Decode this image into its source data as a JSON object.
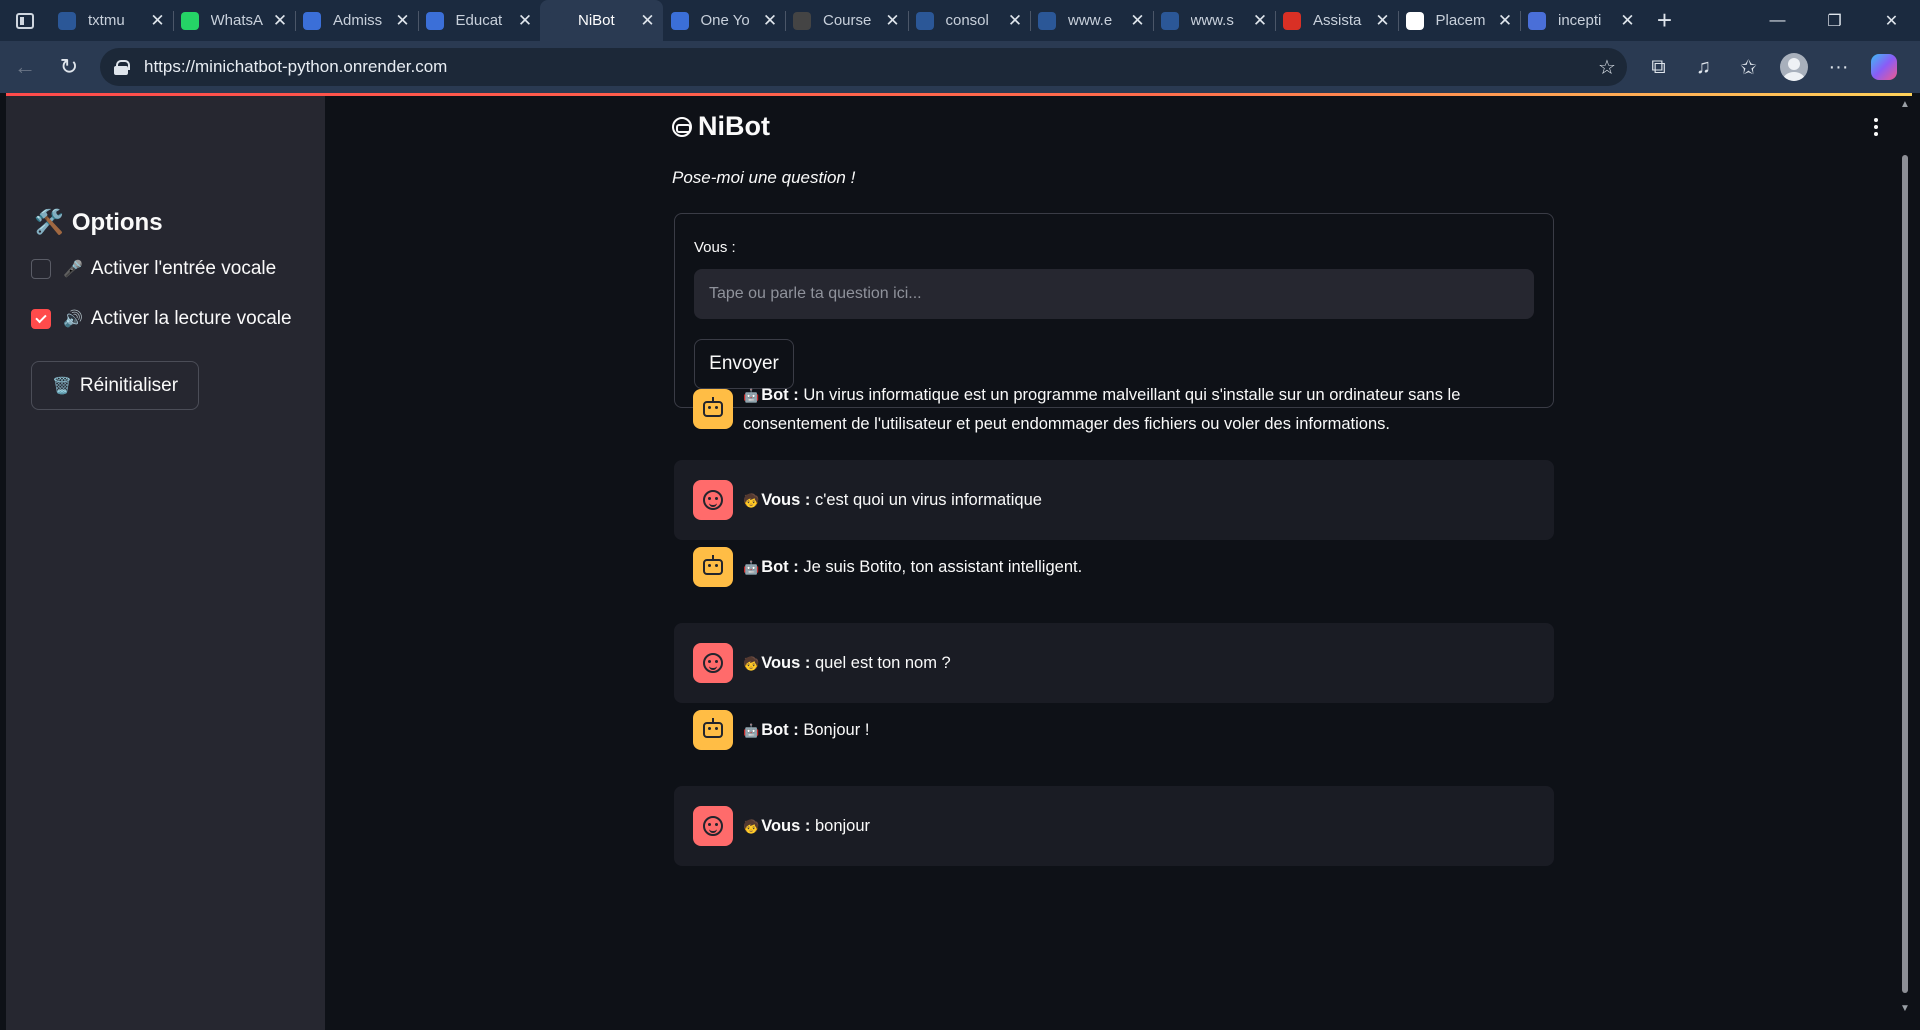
{
  "browser": {
    "tabs": [
      {
        "title": "txtmu",
        "favicon": "page-icon",
        "color": "#2b5797"
      },
      {
        "title": "WhatsA",
        "favicon": "whatsapp-icon",
        "color": "#25d366"
      },
      {
        "title": "Admiss",
        "favicon": "list-icon",
        "color": "#3b6fd8"
      },
      {
        "title": "Educat",
        "favicon": "globe-icon",
        "color": "#3b6fd8"
      },
      {
        "title": "NiBot",
        "favicon": "crown-icon",
        "color": "#2a3a52",
        "active": true
      },
      {
        "title": "One Yo",
        "favicon": "cloud-icon",
        "color": "#3b6fd8"
      },
      {
        "title": "Course",
        "favicon": "course-icon",
        "color": "#444"
      },
      {
        "title": "consol",
        "favicon": "page-icon",
        "color": "#2b5797"
      },
      {
        "title": "www.e",
        "favicon": "page-icon",
        "color": "#2b5797"
      },
      {
        "title": "www.s",
        "favicon": "page-icon",
        "color": "#2b5797"
      },
      {
        "title": "Assista",
        "favicon": "gmail-icon",
        "color": "#d93025"
      },
      {
        "title": "Placem",
        "favicon": "openai-icon",
        "color": "#fff"
      },
      {
        "title": "incepti",
        "favicon": "u-icon",
        "color": "#4a6fd8"
      }
    ],
    "url": "https://minichatbot-python.onrender.com"
  },
  "sidebar": {
    "title": "Options",
    "title_emoji": "🛠️",
    "voice_input": {
      "label": "Activer l'entrée vocale",
      "emoji": "🎤",
      "checked": false
    },
    "voice_output": {
      "label": "Activer la lecture vocale",
      "emoji": "🔊",
      "checked": true
    },
    "reset_button": {
      "label": "Réinitialiser",
      "emoji": "🗑️"
    }
  },
  "main": {
    "title": "NiBot",
    "subtitle": "Pose-moi une question !",
    "form": {
      "label": "Vous :",
      "placeholder": "Tape ou parle ta question ici...",
      "value": "",
      "send_label": "Envoyer"
    },
    "messages": [
      {
        "role": "bot",
        "speaker": "Bot",
        "emoji": "🤖",
        "text": "Un virus informatique est un programme malveillant qui s'installe sur un ordinateur sans le consentement de l'utilisateur et peut endommager des fichiers ou voler des informations."
      },
      {
        "role": "user",
        "speaker": "Vous",
        "emoji": "🧒",
        "text": "c'est quoi un virus informatique"
      },
      {
        "role": "bot",
        "speaker": "Bot",
        "emoji": "🤖",
        "text": "Je suis Botito, ton assistant intelligent."
      },
      {
        "role": "user",
        "speaker": "Vous",
        "emoji": "🧒",
        "text": "quel est ton nom ?"
      },
      {
        "role": "bot",
        "speaker": "Bot",
        "emoji": "🤖",
        "text": "Bonjour !"
      },
      {
        "role": "user",
        "speaker": "Vous",
        "emoji": "🧒",
        "text": "bonjour"
      }
    ]
  },
  "colors": {
    "accent": "#ff4b4b",
    "bot_avatar": "#ffbd45",
    "user_avatar": "#ff6b6b",
    "app_background": "#0e1117",
    "sidebar_background": "#262730"
  }
}
